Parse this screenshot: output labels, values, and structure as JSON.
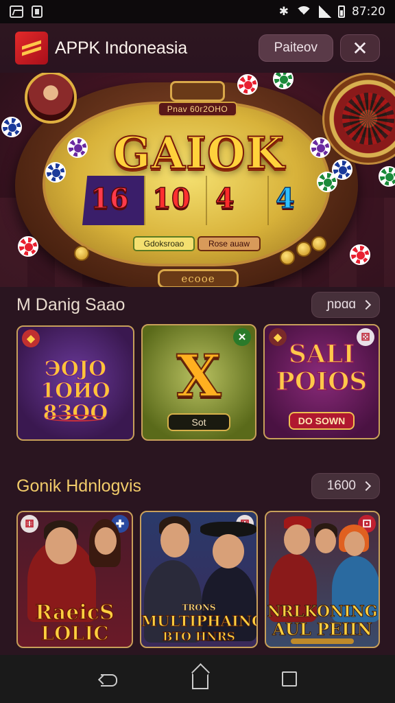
{
  "status_bar": {
    "time": "87:20"
  },
  "header": {
    "app_name": "APPK Indoneasia",
    "action_button": "Paiteov",
    "close_symbol": "✕"
  },
  "hero": {
    "plaque": "Pnav 60г2ОНО",
    "title": "GAIOK",
    "numbers": [
      "16",
      "10",
      "4",
      "4"
    ],
    "button_left": "Gdoksroao",
    "button_right": "Rose auaw",
    "bottom_label": "ecooe"
  },
  "section1": {
    "title": "M Danig Saao",
    "more_label": "ɲɒɑɑ",
    "cards": [
      {
        "title": "ЭOJO 1ОИО 8ЗOO",
        "subtitle": ""
      },
      {
        "title": "X",
        "pill": "Sot"
      },
      {
        "title": "SALI POIOS",
        "pill": "DO SOWN"
      }
    ]
  },
  "section2": {
    "title": "Gonik Hdnlogvis",
    "more_label": "1600",
    "cards": [
      {
        "title_line1": "RaeicS",
        "title_line2": "LOLIC"
      },
      {
        "title_line0": "TRONS",
        "title_line1": "MULTIPHAING",
        "title_line2": "BTO HNRS"
      },
      {
        "title_line1": "NRLKONING",
        "title_line2": "AUL PEIIN"
      }
    ]
  },
  "colors": {
    "accent_gold": "#f1cb6a",
    "background": "#2a1520",
    "card_border": "#c8a05a"
  }
}
